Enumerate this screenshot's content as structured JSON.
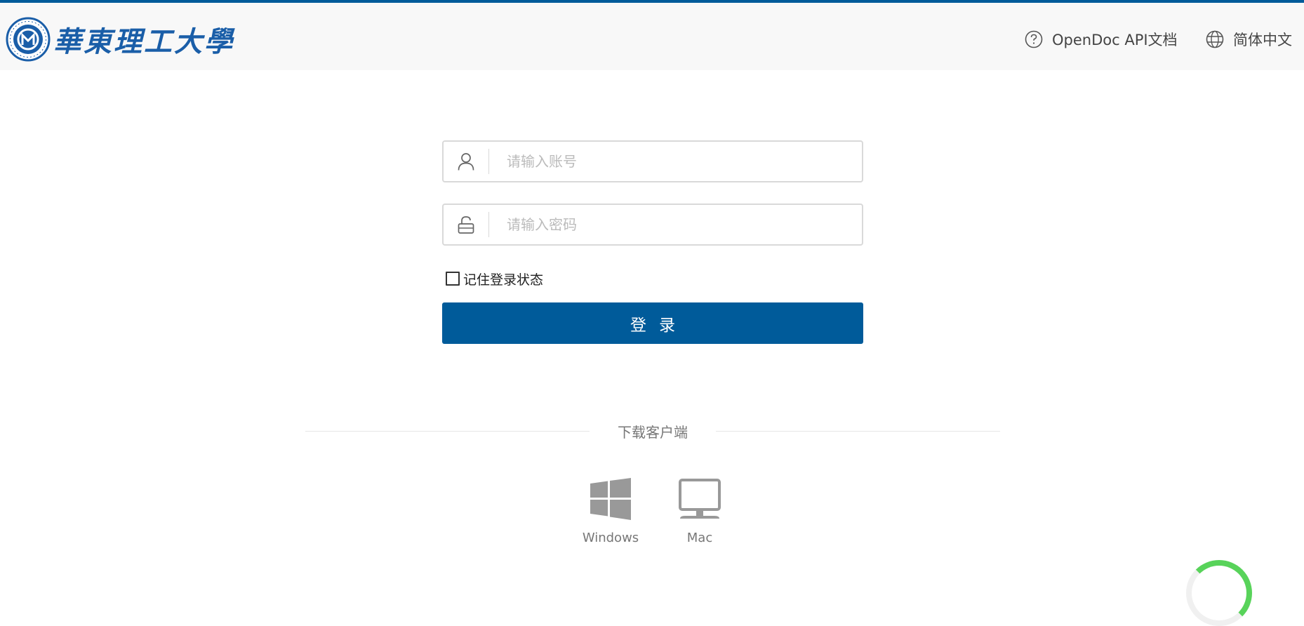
{
  "header": {
    "logo_text": "華東理工大學",
    "logo_seal_alt": "ECUST seal",
    "api_link_label": "OpenDoc API文档",
    "language_label": "简体中文"
  },
  "login_form": {
    "account_placeholder": "请输入账号",
    "password_placeholder": "请输入密码",
    "remember_label": "记住登录状态",
    "remember_checked": false,
    "login_button_label": "登录"
  },
  "download": {
    "title": "下载客户端",
    "clients": [
      {
        "label": "Windows",
        "icon": "windows-icon"
      },
      {
        "label": "Mac",
        "icon": "monitor-icon"
      }
    ]
  },
  "colors": {
    "brand": "#005b9a",
    "logo": "#1a5ea8",
    "header_bg": "#f8f8f8",
    "widget_accent": "#58d35a"
  }
}
